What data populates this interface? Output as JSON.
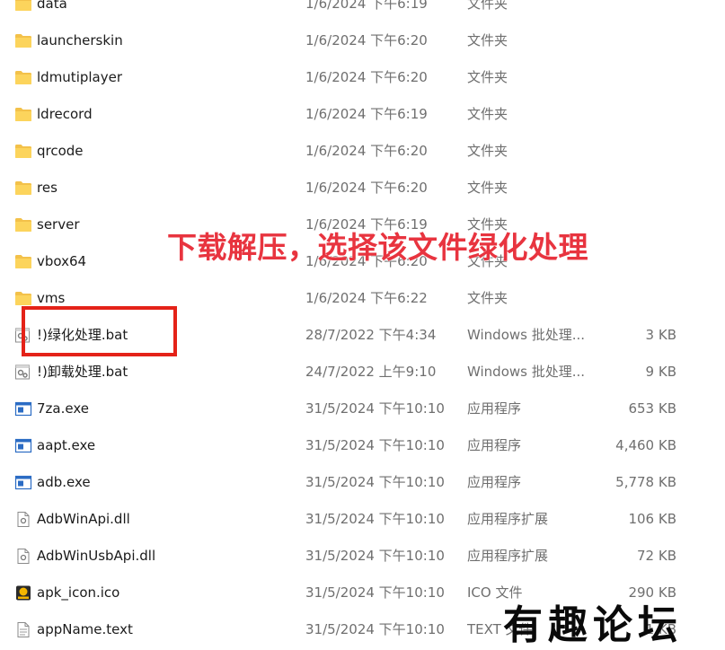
{
  "files": [
    {
      "name": "data",
      "date": "1/6/2024 下午6:19",
      "type": "文件夹",
      "size": "",
      "icon": "folder-icon"
    },
    {
      "name": "launcherskin",
      "date": "1/6/2024 下午6:20",
      "type": "文件夹",
      "size": "",
      "icon": "folder-icon"
    },
    {
      "name": "ldmutiplayer",
      "date": "1/6/2024 下午6:20",
      "type": "文件夹",
      "size": "",
      "icon": "folder-icon"
    },
    {
      "name": "ldrecord",
      "date": "1/6/2024 下午6:19",
      "type": "文件夹",
      "size": "",
      "icon": "folder-icon"
    },
    {
      "name": "qrcode",
      "date": "1/6/2024 下午6:20",
      "type": "文件夹",
      "size": "",
      "icon": "folder-icon"
    },
    {
      "name": "res",
      "date": "1/6/2024 下午6:20",
      "type": "文件夹",
      "size": "",
      "icon": "folder-icon"
    },
    {
      "name": "server",
      "date": "1/6/2024 下午6:19",
      "type": "文件夹",
      "size": "",
      "icon": "folder-icon"
    },
    {
      "name": "vbox64",
      "date": "1/6/2024 下午6:20",
      "type": "文件夹",
      "size": "",
      "icon": "folder-icon"
    },
    {
      "name": "vms",
      "date": "1/6/2024 下午6:22",
      "type": "文件夹",
      "size": "",
      "icon": "folder-icon"
    },
    {
      "name": "!)绿化处理.bat",
      "date": "28/7/2022 下午4:34",
      "type": "Windows 批处理...",
      "size": "3 KB",
      "icon": "batch-file-icon"
    },
    {
      "name": "!)卸载处理.bat",
      "date": "24/7/2022 上午9:10",
      "type": "Windows 批处理...",
      "size": "9 KB",
      "icon": "batch-file-icon"
    },
    {
      "name": "7za.exe",
      "date": "31/5/2024 下午10:10",
      "type": "应用程序",
      "size": "653 KB",
      "icon": "application-icon"
    },
    {
      "name": "aapt.exe",
      "date": "31/5/2024 下午10:10",
      "type": "应用程序",
      "size": "4,460 KB",
      "icon": "application-icon"
    },
    {
      "name": "adb.exe",
      "date": "31/5/2024 下午10:10",
      "type": "应用程序",
      "size": "5,778 KB",
      "icon": "application-icon"
    },
    {
      "name": "AdbWinApi.dll",
      "date": "31/5/2024 下午10:10",
      "type": "应用程序扩展",
      "size": "106 KB",
      "icon": "dll-file-icon"
    },
    {
      "name": "AdbWinUsbApi.dll",
      "date": "31/5/2024 下午10:10",
      "type": "应用程序扩展",
      "size": "72 KB",
      "icon": "dll-file-icon"
    },
    {
      "name": "apk_icon.ico",
      "date": "31/5/2024 下午10:10",
      "type": "ICO 文件",
      "size": "290 KB",
      "icon": "ico-file-icon"
    },
    {
      "name": "appName.text",
      "date": "31/5/2024 下午10:10",
      "type": "TEXT 文件",
      "size": "1 KB",
      "icon": "text-file-icon"
    }
  ],
  "annotation": {
    "instruction": "下载解压，选择该文件绿化处理",
    "watermark": "有趣论坛",
    "highlight_color": "#e42218",
    "text_color": "#e8343f"
  }
}
